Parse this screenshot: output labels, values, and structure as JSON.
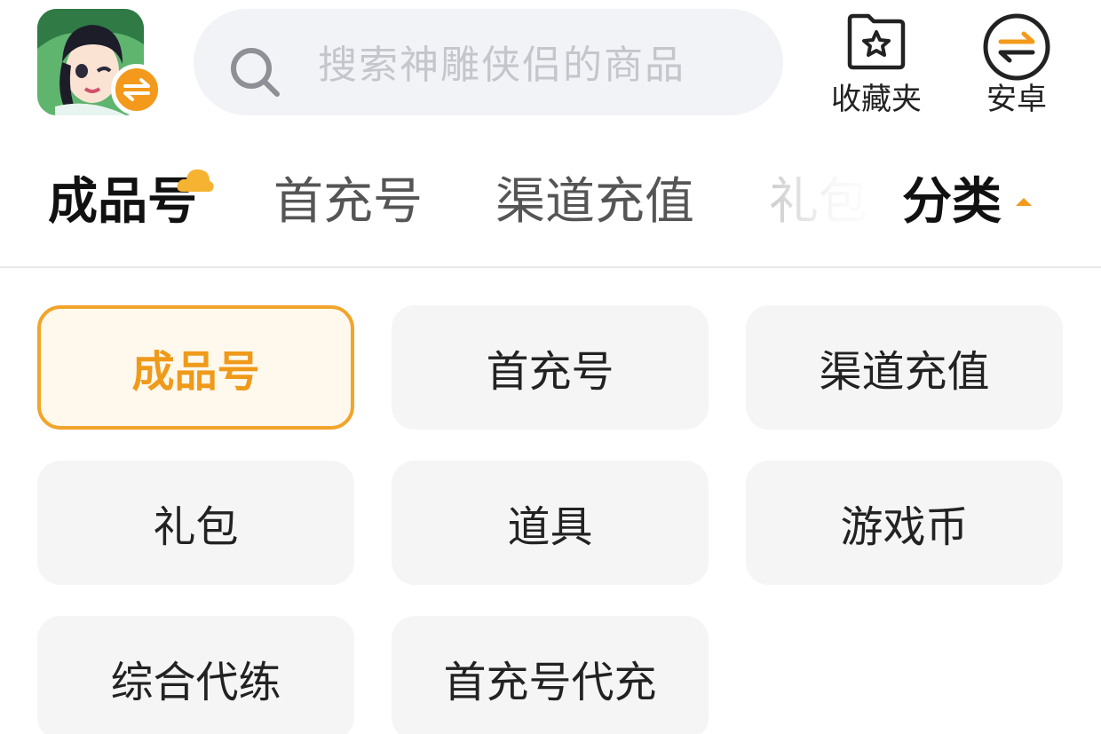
{
  "header": {
    "game_icon": "game-avatar-icon",
    "platform_switch_icon": "swap-icon",
    "search": {
      "placeholder": "搜索神雕侠侣的商品",
      "icon": "search-icon"
    },
    "favorites": {
      "label": "收藏夹",
      "icon": "star-folder-icon"
    },
    "platform": {
      "label": "安卓",
      "icon": "swap-icon"
    }
  },
  "tabs": {
    "items": [
      {
        "label": "成品号",
        "active": true
      },
      {
        "label": "首充号",
        "active": false
      },
      {
        "label": "渠道充值",
        "active": false
      },
      {
        "label": "礼包",
        "active": false
      }
    ],
    "category_toggle": {
      "label": "分类",
      "icon": "caret-up-icon"
    }
  },
  "categories": [
    {
      "label": "成品号",
      "selected": true
    },
    {
      "label": "首充号",
      "selected": false
    },
    {
      "label": "渠道充值",
      "selected": false
    },
    {
      "label": "礼包",
      "selected": false
    },
    {
      "label": "道具",
      "selected": false
    },
    {
      "label": "游戏币",
      "selected": false
    },
    {
      "label": "综合代练",
      "selected": false
    },
    {
      "label": "首充号代充",
      "selected": false
    }
  ],
  "colors": {
    "accent": "#f39a1c",
    "selected_border": "#f1a52b",
    "selected_bg": "#fff8ec",
    "chip_bg": "#f5f5f5",
    "search_bg": "#f2f3f7"
  }
}
